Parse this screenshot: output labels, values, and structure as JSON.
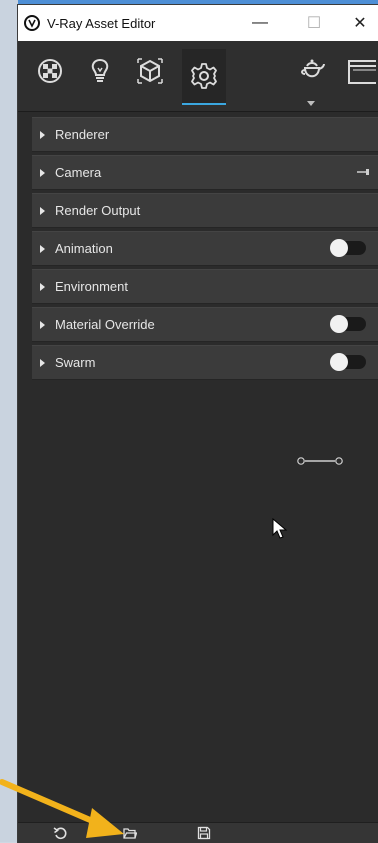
{
  "window": {
    "title": "V-Ray Asset Editor",
    "controls": {
      "minimize": "—",
      "maximize": "☐",
      "close": "✕"
    }
  },
  "toolbar": {
    "buttons": [
      {
        "name": "materials",
        "icon": "materials-icon",
        "active": false
      },
      {
        "name": "lights",
        "icon": "light-bulb-icon",
        "active": false
      },
      {
        "name": "geometry",
        "icon": "cube-icon",
        "active": false
      },
      {
        "name": "settings",
        "icon": "gear-icon",
        "active": true
      },
      {
        "name": "render",
        "icon": "teapot-icon",
        "active": false
      },
      {
        "name": "frame-buffer",
        "icon": "window-icon",
        "active": false
      }
    ]
  },
  "rollouts": {
    "items": [
      {
        "label": "Renderer",
        "toggle": null
      },
      {
        "label": "Camera",
        "toggle": null
      },
      {
        "label": "Render Output",
        "toggle": null
      },
      {
        "label": "Animation",
        "toggle": true
      },
      {
        "label": "Environment",
        "toggle": null
      },
      {
        "label": "Material Override",
        "toggle": true
      },
      {
        "label": "Swarm",
        "toggle": true
      }
    ]
  },
  "bottombar": {
    "buttons": [
      {
        "name": "reset",
        "icon": "undo-icon"
      },
      {
        "name": "open",
        "icon": "folder-open-icon"
      },
      {
        "name": "save",
        "icon": "save-icon"
      }
    ]
  },
  "colors": {
    "panel": "#2b2b2b",
    "rollout": "#3b3b3b",
    "accent": "#3ba7e0",
    "annotation": "#f2b21b"
  }
}
